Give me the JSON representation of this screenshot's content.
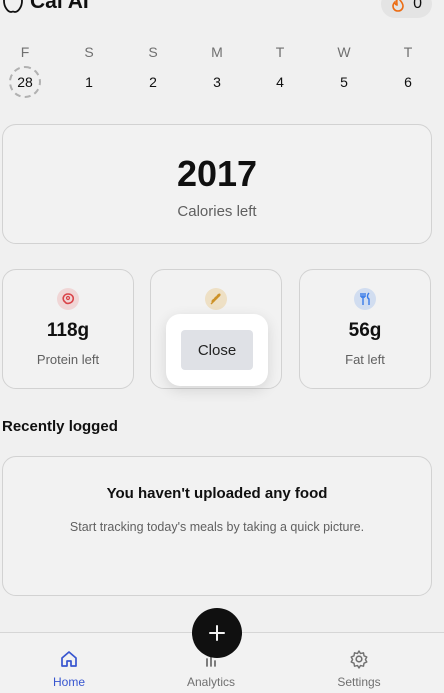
{
  "header": {
    "app_name": "Cal AI",
    "logo_icon": "apple-icon",
    "streak_icon": "flame-icon",
    "streak_count": "0"
  },
  "week": {
    "days": [
      {
        "letter": "F",
        "number": "28",
        "today": true
      },
      {
        "letter": "S",
        "number": "1"
      },
      {
        "letter": "S",
        "number": "2"
      },
      {
        "letter": "M",
        "number": "3"
      },
      {
        "letter": "T",
        "number": "4"
      },
      {
        "letter": "W",
        "number": "5"
      },
      {
        "letter": "T",
        "number": "6"
      }
    ]
  },
  "calories": {
    "value": "2017",
    "label": "Calories left"
  },
  "macros": [
    {
      "icon": "steak-icon",
      "color": "#e5484d",
      "value": "118g",
      "label": "Protein left"
    },
    {
      "icon": "wheat-icon",
      "color": "#d99a2b",
      "value": "",
      "label": ""
    },
    {
      "icon": "fork-knife-icon",
      "color": "#3b82f6",
      "value": "56g",
      "label": "Fat left"
    }
  ],
  "recent": {
    "title": "Recently logged",
    "empty_title": "You haven't uploaded any food",
    "empty_text": "Start tracking today's meals by taking a quick picture."
  },
  "nav": {
    "items": [
      {
        "icon": "home-icon",
        "label": "Home",
        "active": true
      },
      {
        "icon": "bar-chart-icon",
        "label": "Analytics"
      },
      {
        "icon": "gear-icon",
        "label": "Settings"
      }
    ],
    "fab_icon": "plus-icon"
  },
  "dialog": {
    "close_label": "Close"
  },
  "colors": {
    "accent": "#3b5bdb",
    "fab": "#111111"
  }
}
